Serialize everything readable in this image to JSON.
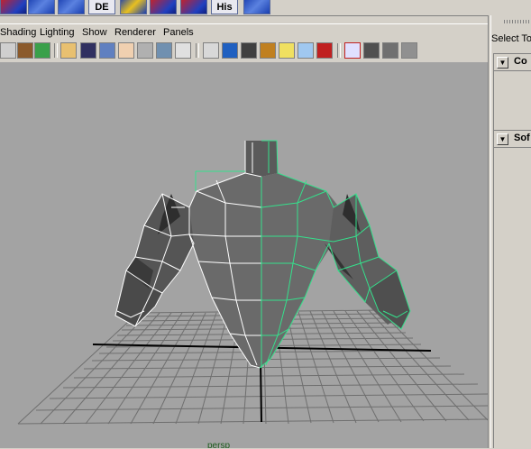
{
  "shelf": {
    "buttons": [
      {
        "name": "shelf-tool-1",
        "label": ""
      },
      {
        "name": "shelf-tool-2",
        "label": ""
      },
      {
        "name": "shelf-tool-3",
        "label": ""
      },
      {
        "name": "shelf-tool-de",
        "label": "DE"
      },
      {
        "name": "shelf-tool-5",
        "label": ""
      },
      {
        "name": "shelf-tool-6",
        "label": ""
      },
      {
        "name": "shelf-tool-7",
        "label": ""
      },
      {
        "name": "shelf-tool-his",
        "label": "His"
      },
      {
        "name": "shelf-tool-9",
        "label": ""
      }
    ]
  },
  "panel_menu": {
    "shading": "Shading",
    "lighting": "Lighting",
    "show": "Show",
    "renderer": "Renderer",
    "panels": "Panels"
  },
  "viewport": {
    "camera_label": "persp",
    "background": "#a3a3a3",
    "selection_color": "#35e08c",
    "wire_color": "#ffffff"
  },
  "tool_settings": {
    "title": "Select To",
    "frames": [
      {
        "label": "Co",
        "collapse_icon": "triangle-down"
      },
      {
        "label": "Sof",
        "collapse_icon": "triangle-down"
      }
    ]
  }
}
